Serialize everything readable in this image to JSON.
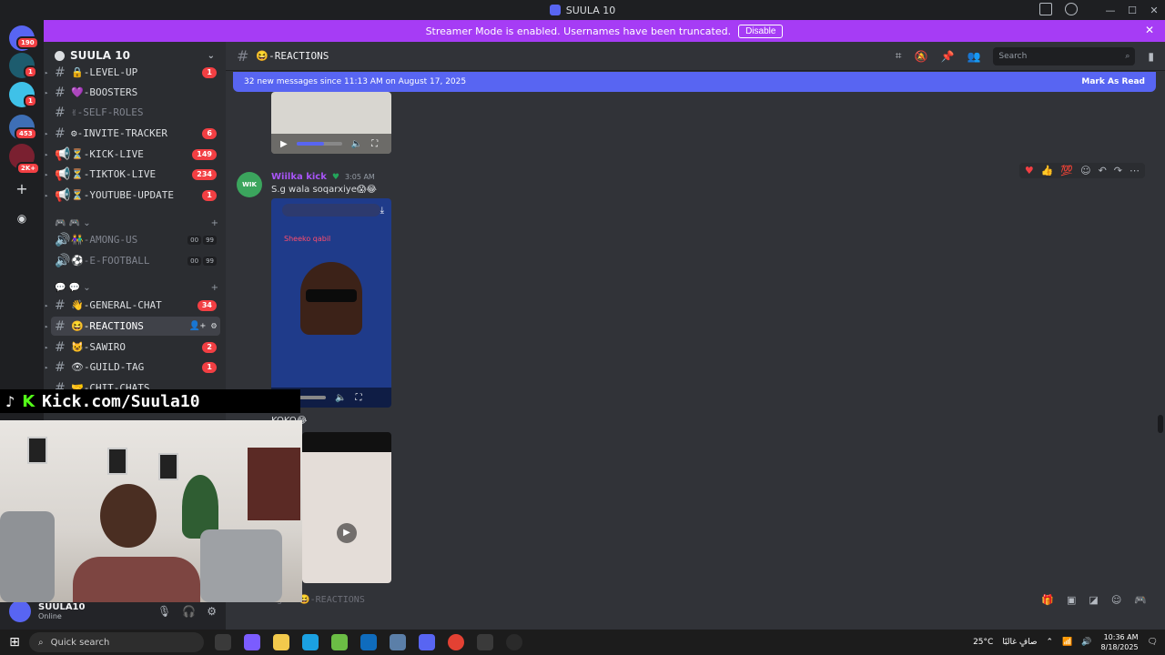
{
  "window": {
    "title": "SUULA 10"
  },
  "banner": {
    "text": "Streamer Mode is enabled. Usernames have been truncated.",
    "disable_label": "Disable"
  },
  "guilds": {
    "badges": [
      "190",
      "1",
      "1",
      "453",
      "2K+"
    ]
  },
  "server": {
    "name": "SUULA 10"
  },
  "channels": [
    {
      "name": "🔒-LEVEL-UP",
      "type": "text",
      "badge": "1"
    },
    {
      "name": "💜-BOOSTERS",
      "type": "text",
      "badge": ""
    },
    {
      "name": "✌-SELF-ROLES",
      "type": "text",
      "badge": ""
    },
    {
      "name": "⚙-INVITE-TRACKER",
      "type": "text",
      "badge": "6"
    },
    {
      "name": "⏳-KICK-LIVE",
      "type": "announce",
      "badge": "149"
    },
    {
      "name": "⏳-TIKTOK-LIVE",
      "type": "announce",
      "badge": "234"
    },
    {
      "name": "⏳-YOUTUBE-UPDATE",
      "type": "announce",
      "badge": "1"
    },
    {
      "name": "👫-AMONG-US",
      "type": "voice",
      "vc": [
        "00",
        "99"
      ]
    },
    {
      "name": "⚽-E-FOOTBALL",
      "type": "voice",
      "vc": [
        "00",
        "99"
      ]
    },
    {
      "name": "👋-GENERAL-CHAT",
      "type": "text",
      "badge": "34"
    },
    {
      "name": "😆-REACTIONS",
      "type": "text",
      "badge": ""
    },
    {
      "name": "😺-SAWIRO",
      "type": "text",
      "badge": "2"
    },
    {
      "name": "👁-GUILD-TAG",
      "type": "text",
      "badge": "1"
    },
    {
      "name": "🤝-CHIT-CHATS",
      "type": "text",
      "badge": ""
    }
  ],
  "categories": [
    {
      "label": "🎮 🎮 ⌄",
      "plus": "+"
    },
    {
      "label": "💬 💬 ⌄",
      "plus": "+"
    }
  ],
  "user": {
    "name": "SUULA10",
    "status": "Online"
  },
  "header": {
    "channel_name": "😆-REACTIONS",
    "search_placeholder": "Search"
  },
  "new_messages": {
    "text": "32 new messages since 11:13 AM on August 17, 2025",
    "mark_label": "Mark As Read"
  },
  "message": {
    "author": "Wiilka kick",
    "time": "3:05 AM",
    "text": "S.g wala soqarxiye😱😂",
    "avatar_text": "WIK",
    "video_top_text": "Sheeko qabil"
  },
  "message2_text": "KOKO😂",
  "input": {
    "placeholder": "Message #😆-REACTIONS"
  },
  "overlay": {
    "brand_letter": "K",
    "text": "Kick.com/Suula10"
  },
  "taskbar": {
    "search_placeholder": "Quick search",
    "weather": "25°C",
    "weather_text": "صافٍ غالبًا",
    "time": "10:36 AM",
    "date": "8/18/2025"
  }
}
